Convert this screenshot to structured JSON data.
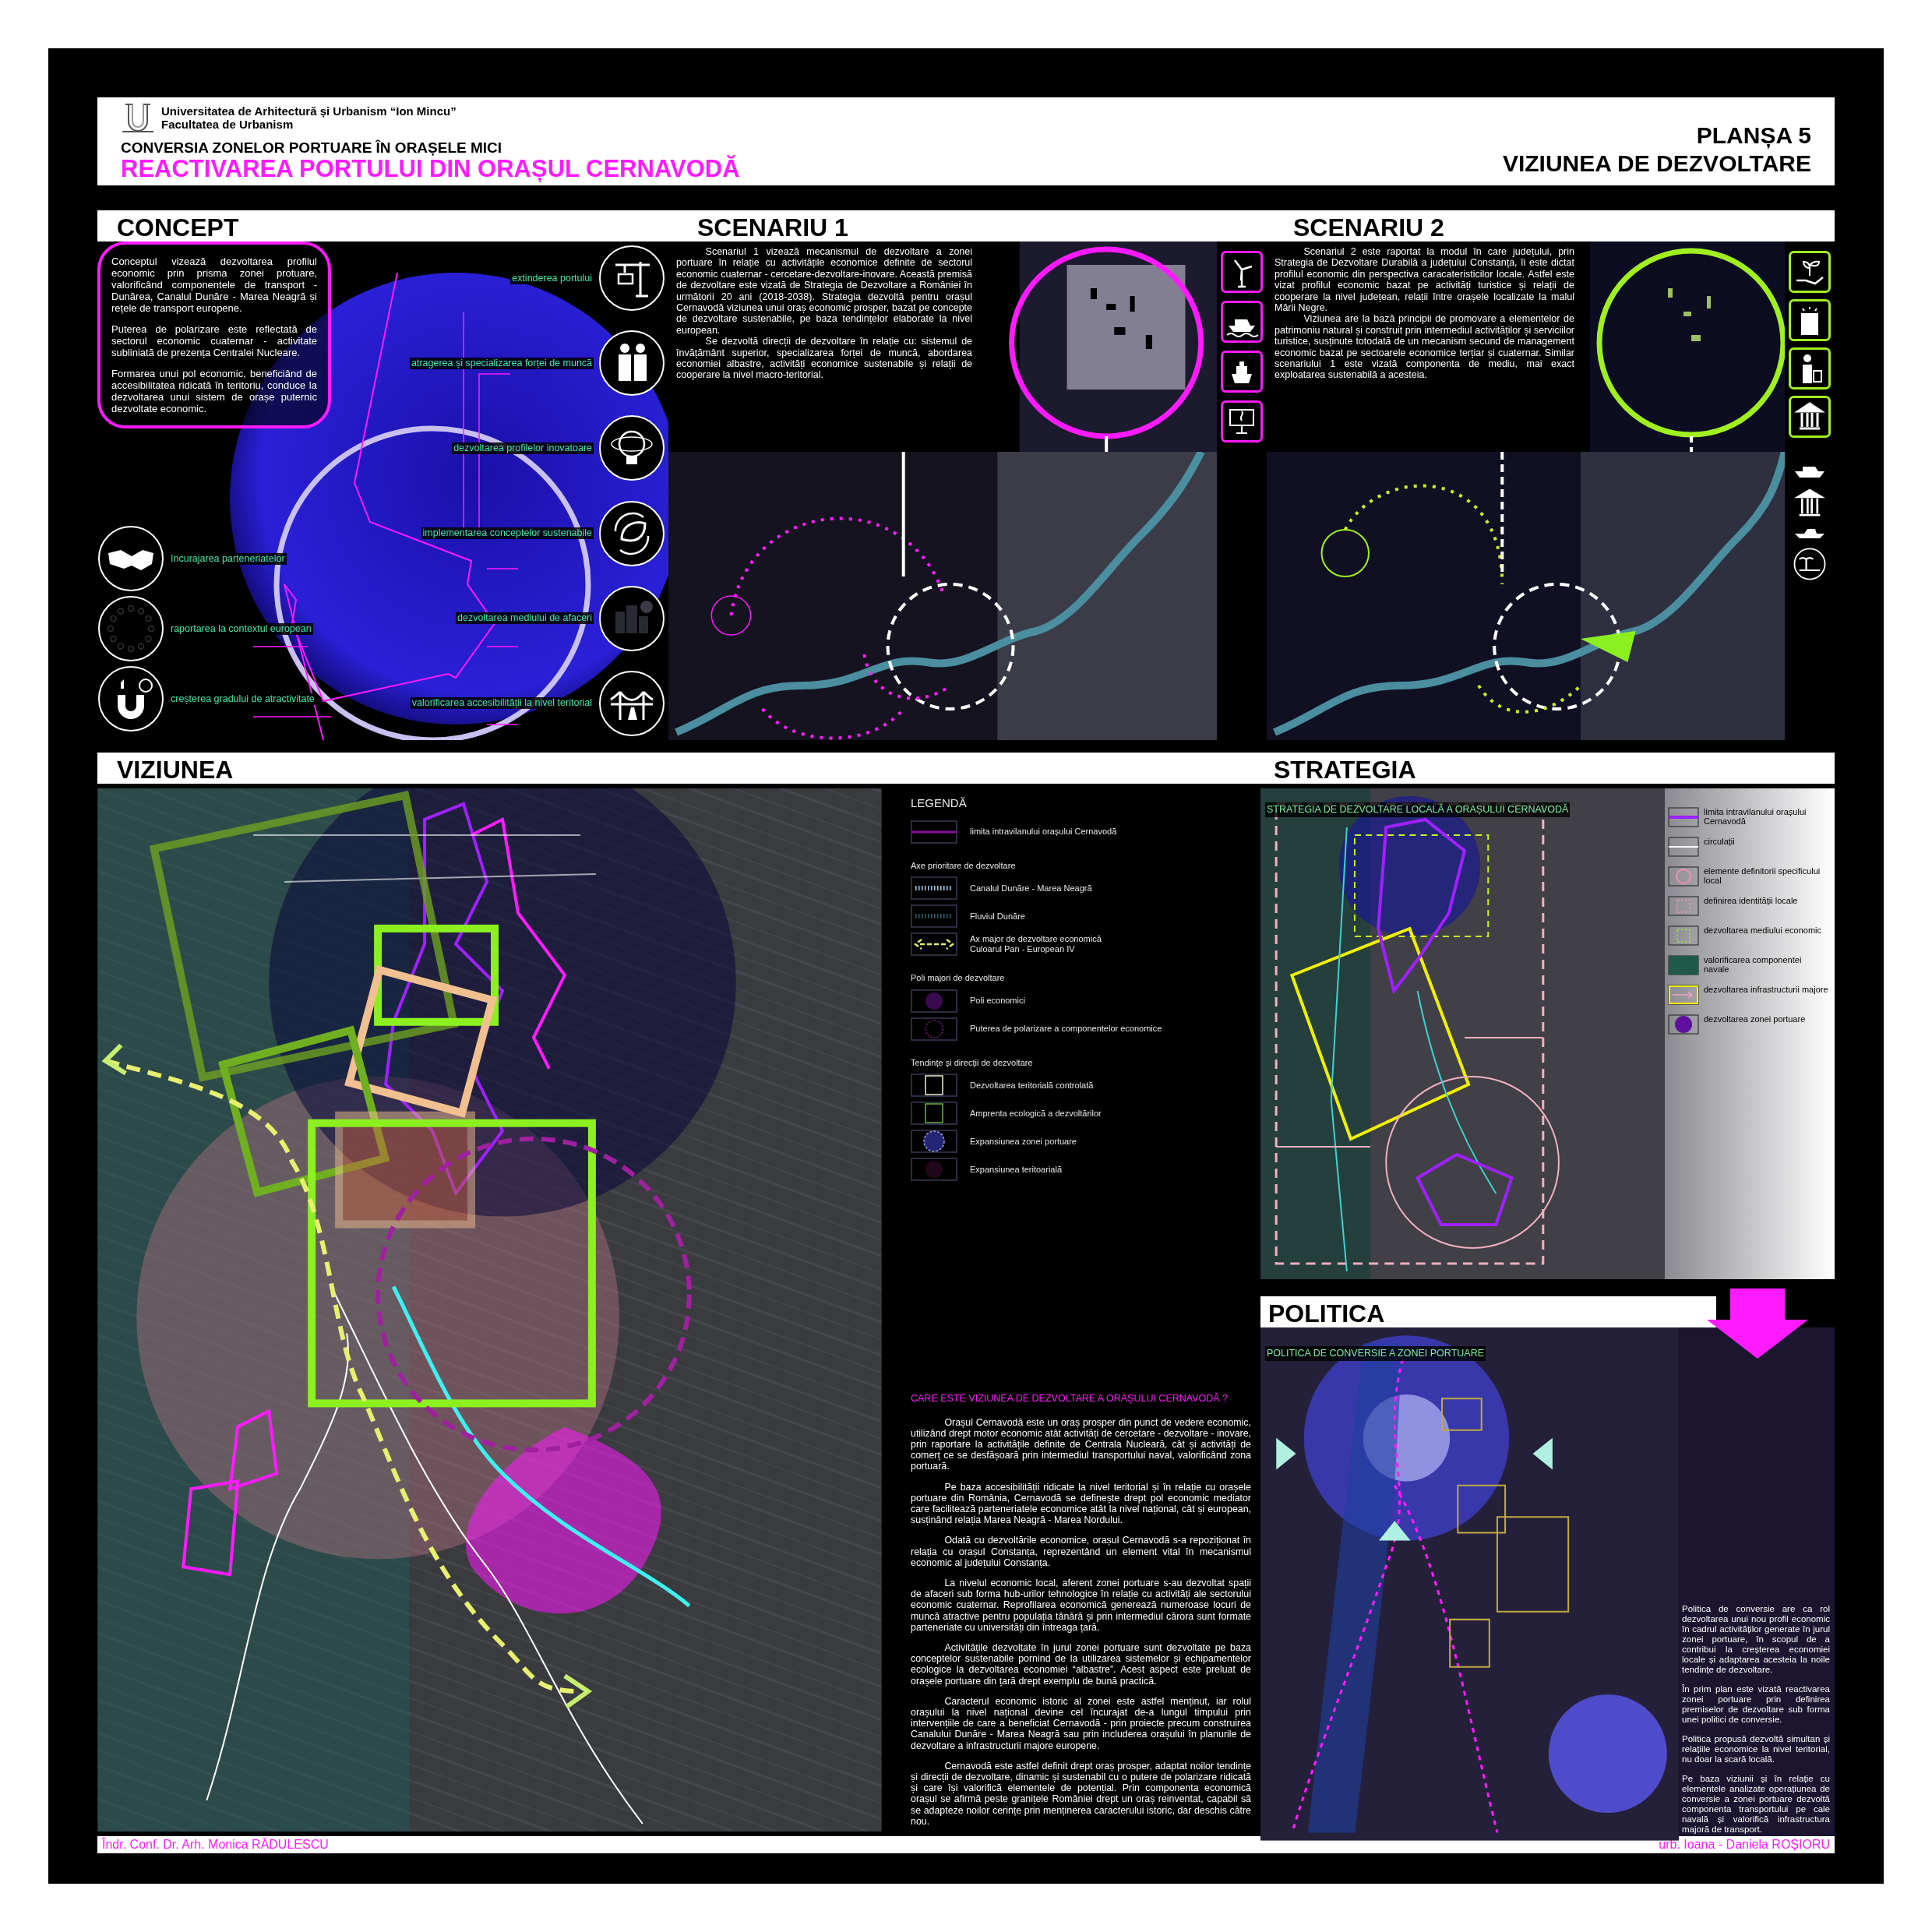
{
  "header": {
    "university": "Universitatea de Arhitectură și Urbanism “Ion Mincu”",
    "faculty": "Facultatea de Urbanism",
    "subtitle": "CONVERSIA ZONELOR PORTUARE ÎN ORAȘELE MICI",
    "title": "REACTIVAREA PORTULUI DIN ORAȘUL CERNAVODĂ",
    "sheet": "PLANȘA 5",
    "sheet_title": "VIZIUNEA DE DEZVOLTARE"
  },
  "concept": {
    "heading": "CONCEPT",
    "paragraphs": [
      "Conceptul vizează dezvoltarea profilul economic prin prisma zonei protuare, valorificând componentele de transport - Dunărea, Canalul Dunăre - Marea Neagră și rețele de transport europene.",
      "Puterea de polarizare este reflectată de sectorul economic cuaternar - activitate subliniată de prezența Centralei Nucleare.",
      "Formarea unui pol economic, beneficiând de accesibilitatea ridicată în teritoriu, conduce la dezvoltarea unui sistem de orașe puternic dezvoltate economic."
    ],
    "left_items": [
      "încurajarea parteneriatelor",
      "raportarea la contextul european",
      "creșterea gradului de atractivitate"
    ],
    "right_items": [
      "extinderea portului",
      "atragerea și specializarea forței de muncă",
      "dezvoltarea profilelor inovatoare",
      "implementarea conceptelor sustenabile",
      "dezvoltarea mediului de afaceri",
      "valorificarea accesibilității la nivel teritorial"
    ]
  },
  "scenario_1": {
    "heading": "SCENARIU 1",
    "paragraphs": [
      "Scenariul 1 vizează mecanismul de dezvoltare a zonei portuare în relație cu activitățile economice definite de sectorul economic cuaternar - cercetare-dezvoltare-inovare. Această premisă de dezvoltare este vizată de Strategia de Dezvoltare a României în următorii 20 ani (2018-2038). Strategia dezvoltă pentru orașul Cernavodă viziunea unui oraș economic prosper, bazat pe concepte de dezvoltare sustenabile, pe baza tendințelor elaborate la nivel european.",
      "Se dezvoltă direcții de dezvoltare în relație cu: sistemul de învățământ superior, specializarea forței de muncă, abordarea economiei albastre, activități economice sustenabile și relații de cooperare la nivel macro-teritorial."
    ]
  },
  "scenario_2": {
    "heading": "SCENARIU 2",
    "paragraphs": [
      "Scenariul 2 este raportat la modul în care județului, prin Strategia de Dezvoltare Durabilă a județului Constanța, îi este dictat profilul economic din perspectiva caracateristicilor locale. Astfel este vizat profilul economic bazat pe activități turistice și relații de cooperare la nivel județean, relații între orașele localizate la malul Mării Negre.",
      "Viziunea are la bază principii de promovare a elementelor de patrimoniu natural și construit prin intermediul activităților și serviciilor turistice, susținute totodată de un mecanism secund de management economic bazat pe sectoarele economice terțiar și cuaternar. Similar scenariului 1 este vizată componenta de mediu, mai exact exploatarea sustenabilă a acesteia."
    ]
  },
  "viziunea": {
    "heading": "VIZIUNEA"
  },
  "legend": {
    "title": "LEGENDĂ",
    "items": [
      {
        "kind": "boundary",
        "label": "limita intravilanului orașului Cernavodă"
      },
      {
        "kind": "heading",
        "label": "Axe prioritare de dezvoltare"
      },
      {
        "kind": "canal",
        "label": "Canalul Dunăre - Marea Neagră"
      },
      {
        "kind": "river",
        "label": "Fluviul Dunăre"
      },
      {
        "kind": "axis",
        "label": "Ax major de dezvoltare economică\nCuloarul Pan - European IV"
      },
      {
        "kind": "heading",
        "label": "Poli majori de dezvoltare"
      },
      {
        "kind": "pole",
        "label": "Poli economici"
      },
      {
        "kind": "polarization",
        "label": "Puterea de polarizare a componentelor economice"
      },
      {
        "kind": "heading",
        "label": "Tendințe și direcții de dezvoltare"
      },
      {
        "kind": "controlled",
        "label": "Dezvoltarea teritorială controlată"
      },
      {
        "kind": "footprint",
        "label": "Amprenta ecologică a dezvoltărilor"
      },
      {
        "kind": "port",
        "label": "Expansiunea zonei portuare"
      },
      {
        "kind": "territorial",
        "label": "Expansiunea teritoarială"
      }
    ]
  },
  "vision_text": {
    "question": "CARE ESTE VIZIUNEA DE DEZVOLTARE A ORAȘULUI CERNAVODĂ ?",
    "paragraphs": [
      "Orașul Cernavodă este un oraș prosper din punct de vedere economic, utilizând drept motor economic atât activități de cercetare - dezvoltare - inovare, prin raportare la activitățile definite de Centrala Nucleară, cât și activități de comerț ce se desfășoară prin intermediul transportului naval, valorificând zona portuară.",
      "Pe baza accesibilității ridicate la nivel teritorial și în relație cu orașele portuare din România, Cernavodă se definește drept pol economic mediator care facilitează parteneriatele economice atât la nivel național, cât și european, susținând relația Marea Neagră - Marea Nordului.",
      "Odată cu dezvoltările economice, orașul Cernavodă s-a repoziționat în relația cu orașul Constanța, reprezentând un element vital în mecanismul economic al județului Constanța.",
      "La nivelul economic local, aferent zonei portuare s-au dezvoltat spații de afaceri sub forma hub-urilor tehnologice în relație cu activități ale sectorului economic cuaternar. Reprofilarea economică generează numeroase locuri de muncă atractive pentru populația tânără și prin intermediul cărora sunt formate parteneriate cu universități din întreaga țară.",
      "Activitățile dezvoltate în jurul zonei portuare sunt dezvoltate pe baza conceptelor sustenabile pornind de la utilizarea sistemelor și echipamentelor ecologice la dezvoltarea economiei “albastre”. Acest aspect este preluat de orașele portuare din țară drept exemplu de bună practică.",
      "Caracterul economic istoric al zonei este astfel menținut, iar rolul orașului la nivel național devine cel încurajat de-a lungul timpului prin intervențiile de care a beneficiat Cernavodă - prin proiecte precum construirea Canalului Dunăre - Marea Neagră sau prin includerea orașului în planurile de dezvoltare a infrastructurii majore europene.",
      "Cernavodă este astfel definit drept oraș prosper, adaptat noilor tendințe și direcții de dezvoltare, dinamic și sustenabil cu o putere de polarizare ridicată și care își valorifică elementele de potențial. Prin componenta economică orașul se afirmă peste granițele României drept un oraș reinventat, capabil să se adapteze noilor cerințe prin menținerea caracterului istoric, dar deschis către nou."
    ]
  },
  "strategia": {
    "heading": "STRATEGIA",
    "map_label": "STRATEGIA DE DEZVOLTARE LOCALĂ A  ORAȘULUI CERNAVODĂ",
    "legend": [
      {
        "kind": "boundary",
        "label": "limita intravilanului orașului Cernavodă"
      },
      {
        "kind": "road",
        "label": "circulații"
      },
      {
        "kind": "ring",
        "label": "elemente definitorii specificului local"
      },
      {
        "kind": "identity",
        "label": "definirea identității locale"
      },
      {
        "kind": "economic",
        "label": "dezvoltarea mediului economic"
      },
      {
        "kind": "naval",
        "label": "valorificarea componentei navale"
      },
      {
        "kind": "infrastructure",
        "label": "dezvoltarea infrastructurii majore"
      },
      {
        "kind": "port",
        "label": "dezvoltarea zonei portuare"
      }
    ]
  },
  "politica": {
    "heading": "POLITICA",
    "map_label": "POLITICA DE CONVERSIE A ZONEI PORTUARE",
    "paragraphs": [
      "Politica de conversie are ca rol dezvoltarea unui nou profil economic în cadrul activităților generate în jurul zonei portuare, în scopul de a contribui la creșterea economiei locale și adaptarea acesteia la noile tendințe de dezvoltare.",
      "În prim plan este vizată reactivarea zonei portuare prin definirea premiselor de dezvoltare sub forma unei politici de conversie.",
      "Politica propusă dezvoltă simultan și relațiile economice la nivel teritorial, nu doar la scară locală.",
      "Pe baza viziunii și în relație cu elementele analizate operațiunea de conversie a zonei portuare dezvoltă componenta transportului pe cale navală și valorifică infrastructura majoră de transport."
    ]
  },
  "footer": {
    "left": "Îndr. Conf. Dr. Arh. Monica RĂDULESCU",
    "right": "urb. Ioana - Daniela ROȘIORU"
  }
}
